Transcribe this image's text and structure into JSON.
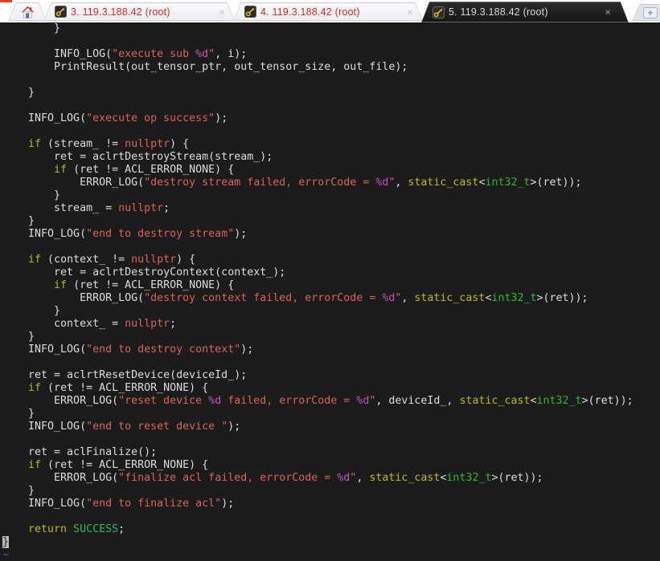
{
  "tab_bar": {
    "close_glyph": "×",
    "new_tab_glyph": "+",
    "tabs": [
      {
        "label": "3. 119.3.188.42 (root)",
        "active": false,
        "icon": "key-icon",
        "closable": true
      },
      {
        "label": "4. 119.3.188.42 (root)",
        "active": false,
        "icon": "key-icon",
        "closable": true
      },
      {
        "label": "5. 119.3.188.42 (root)",
        "active": true,
        "icon": "key-icon",
        "closable": true
      }
    ]
  },
  "colors": {
    "terminal_bg": "#1b1b1b",
    "terminal_fg": "#dcdcdc",
    "keyword": "#b8b821",
    "string": "#d8625a",
    "format_spec": "#bd57bd",
    "type": "#2eb52e",
    "constant": "#2eb56e",
    "tilde": "#3c63d2",
    "cursor_bg": "#b9b9b9",
    "cursor_fg": "#222222",
    "tab_text": "#e6251f",
    "active_tab_fg": "#d8d8d8",
    "key_gold": "#e6b30f"
  },
  "terminal": {
    "lines": [
      [
        [
          "d",
          "        }"
        ]
      ],
      [],
      [
        [
          "d",
          "        INFO_LOG("
        ],
        [
          "s",
          "\"execute sub "
        ],
        [
          "p",
          "%d"
        ],
        [
          "s",
          "\""
        ],
        [
          "d",
          ", i);"
        ]
      ],
      [
        [
          "d",
          "        PrintResult(out_tensor_ptr, out_tensor_size, out_file);"
        ]
      ],
      [],
      [
        [
          "d",
          "    }"
        ]
      ],
      [],
      [
        [
          "d",
          "    INFO_LOG("
        ],
        [
          "s",
          "\"execute op success\""
        ],
        [
          "d",
          ");"
        ]
      ],
      [],
      [
        [
          "d",
          "    "
        ],
        [
          "k",
          "if"
        ],
        [
          "d",
          " (stream_ != "
        ],
        [
          "s",
          "nullptr"
        ],
        [
          "d",
          ") {"
        ]
      ],
      [
        [
          "d",
          "        ret = aclrtDestroyStream(stream_);"
        ]
      ],
      [
        [
          "d",
          "        "
        ],
        [
          "k",
          "if"
        ],
        [
          "d",
          " (ret != ACL_ERROR_NONE) {"
        ]
      ],
      [
        [
          "d",
          "            ERROR_LOG("
        ],
        [
          "s",
          "\"destroy stream failed, errorCode = "
        ],
        [
          "p",
          "%d"
        ],
        [
          "s",
          "\""
        ],
        [
          "d",
          ", "
        ],
        [
          "k",
          "static_cast"
        ],
        [
          "d",
          "<"
        ],
        [
          "t",
          "int32_t"
        ],
        [
          "d",
          ">(ret));"
        ]
      ],
      [
        [
          "d",
          "        }"
        ]
      ],
      [
        [
          "d",
          "        stream_ = "
        ],
        [
          "s",
          "nullptr"
        ],
        [
          "d",
          ";"
        ]
      ],
      [
        [
          "d",
          "    }"
        ]
      ],
      [
        [
          "d",
          "    INFO_LOG("
        ],
        [
          "s",
          "\"end to destroy stream\""
        ],
        [
          "d",
          ");"
        ]
      ],
      [],
      [
        [
          "d",
          "    "
        ],
        [
          "k",
          "if"
        ],
        [
          "d",
          " (context_ != "
        ],
        [
          "s",
          "nullptr"
        ],
        [
          "d",
          ") {"
        ]
      ],
      [
        [
          "d",
          "        ret = aclrtDestroyContext(context_);"
        ]
      ],
      [
        [
          "d",
          "        "
        ],
        [
          "k",
          "if"
        ],
        [
          "d",
          " (ret != ACL_ERROR_NONE) {"
        ]
      ],
      [
        [
          "d",
          "            ERROR_LOG("
        ],
        [
          "s",
          "\"destroy context failed, errorCode = "
        ],
        [
          "p",
          "%d"
        ],
        [
          "s",
          "\""
        ],
        [
          "d",
          ", "
        ],
        [
          "k",
          "static_cast"
        ],
        [
          "d",
          "<"
        ],
        [
          "t",
          "int32_t"
        ],
        [
          "d",
          ">(ret));"
        ]
      ],
      [
        [
          "d",
          "        }"
        ]
      ],
      [
        [
          "d",
          "        context_ = "
        ],
        [
          "s",
          "nullptr"
        ],
        [
          "d",
          ";"
        ]
      ],
      [
        [
          "d",
          "    }"
        ]
      ],
      [
        [
          "d",
          "    INFO_LOG("
        ],
        [
          "s",
          "\"end to destroy context\""
        ],
        [
          "d",
          ");"
        ]
      ],
      [],
      [
        [
          "d",
          "    ret = aclrtResetDevice(deviceId_);"
        ]
      ],
      [
        [
          "d",
          "    "
        ],
        [
          "k",
          "if"
        ],
        [
          "d",
          " (ret != ACL_ERROR_NONE) {"
        ]
      ],
      [
        [
          "d",
          "        ERROR_LOG("
        ],
        [
          "s",
          "\"reset device "
        ],
        [
          "p",
          "%d"
        ],
        [
          "s",
          " failed, errorCode = "
        ],
        [
          "p",
          "%d"
        ],
        [
          "s",
          "\""
        ],
        [
          "d",
          ", deviceId_, "
        ],
        [
          "k",
          "static_cast"
        ],
        [
          "d",
          "<"
        ],
        [
          "t",
          "int32_t"
        ],
        [
          "d",
          ">(ret));"
        ]
      ],
      [
        [
          "d",
          "    }"
        ]
      ],
      [
        [
          "d",
          "    INFO_LOG("
        ],
        [
          "s",
          "\"end to reset device \""
        ],
        [
          "d",
          ");"
        ]
      ],
      [],
      [
        [
          "d",
          "    ret = aclFinalize();"
        ]
      ],
      [
        [
          "d",
          "    "
        ],
        [
          "k",
          "if"
        ],
        [
          "d",
          " (ret != ACL_ERROR_NONE) {"
        ]
      ],
      [
        [
          "d",
          "        ERROR_LOG("
        ],
        [
          "s",
          "\"finalize acl failed, errorCode = "
        ],
        [
          "p",
          "%d"
        ],
        [
          "s",
          "\""
        ],
        [
          "d",
          ", "
        ],
        [
          "k",
          "static_cast"
        ],
        [
          "d",
          "<"
        ],
        [
          "t",
          "int32_t"
        ],
        [
          "d",
          ">(ret));"
        ]
      ],
      [
        [
          "d",
          "    }"
        ]
      ],
      [
        [
          "d",
          "    INFO_LOG("
        ],
        [
          "s",
          "\"end to finalize acl\""
        ],
        [
          "d",
          ");"
        ]
      ],
      [],
      [
        [
          "d",
          "    "
        ],
        [
          "k",
          "return"
        ],
        [
          "d",
          " "
        ],
        [
          "g",
          "SUCCESS"
        ],
        [
          "d",
          ";"
        ]
      ],
      [
        [
          "cur",
          "}"
        ]
      ],
      [
        [
          "nt",
          "~"
        ]
      ]
    ]
  }
}
